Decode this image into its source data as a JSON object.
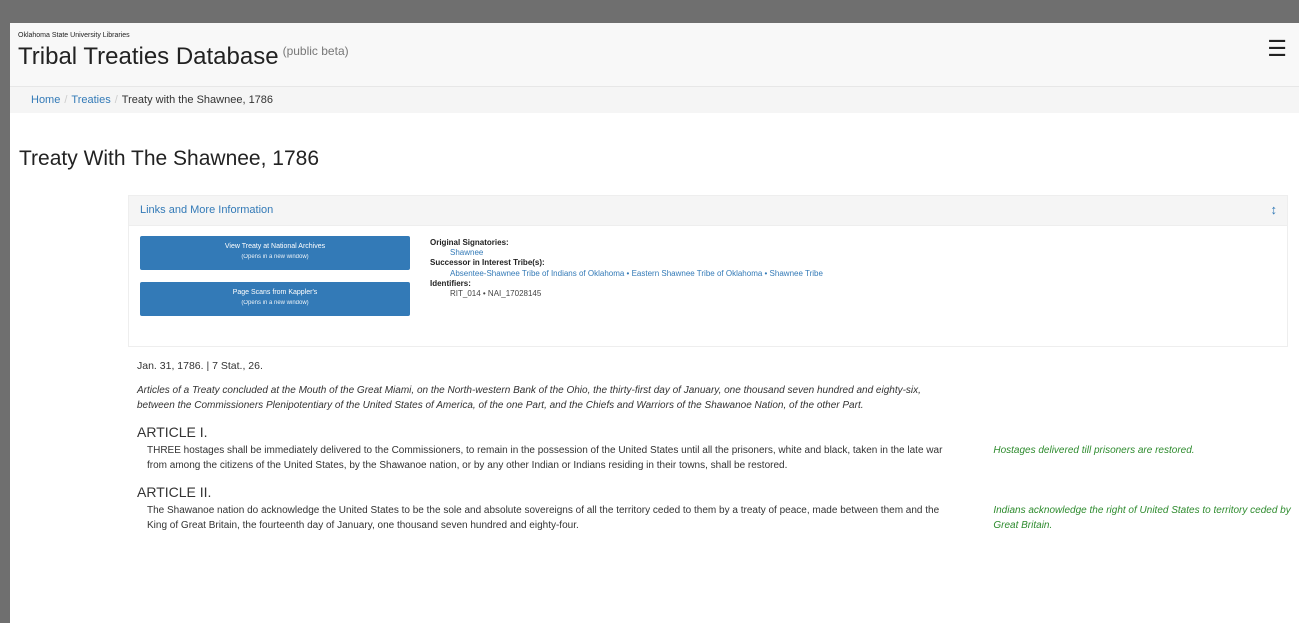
{
  "header": {
    "org": "Oklahoma State University Libraries",
    "title": "Tribal Treaties Database",
    "beta": "(public beta)",
    "menu_icon": "hamburger-icon"
  },
  "breadcrumb": {
    "home": "Home",
    "treaties": "Treaties",
    "current": "Treaty with the Shawnee, 1786"
  },
  "page_title": "Treaty With The Shawnee, 1786",
  "panel": {
    "heading": "Links and More Information",
    "expand_icon": "expand-vertical-icon",
    "button1": {
      "label": "View Treaty at National Archives",
      "sub": "(Opens in a new window)"
    },
    "button2": {
      "label": "Page Scans from Kappler's",
      "sub": "(Opens in a new window)"
    },
    "signatories_label": "Original Signatories:",
    "signatories": "Shawnee",
    "successor_label": "Successor in Interest Tribe(s):",
    "successors": "Absentee-Shawnee Tribe of Indians of Oklahoma • Eastern Shawnee Tribe of Oklahoma • Shawnee Tribe",
    "identifiers_label": "Identifiers:",
    "identifiers": "RIT_014 • NAI_17028145"
  },
  "treaty": {
    "meta": "Jan. 31, 1786. | 7 Stat., 26.",
    "preamble": "Articles of a Treaty concluded at the Mouth of the Great Miami, on the North-western Bank of the Ohio, the thirty-first day of January, one thousand seven hundred and eighty-six, between the Commissioners Plenipotentiary of the United States of America, of the one Part, and the Chiefs and Warriors of the Shawanoe Nation, of the other Part.",
    "articles": [
      {
        "heading": "ARTICLE I.",
        "text": "THREE hostages shall be immediately delivered to the Commissioners, to remain in the possession of the United States until all the prisoners, white and black, taken in the late war from among the citizens of the United States, by the Shawanoe nation, or by any other Indian or Indians residing in their towns, shall be restored.",
        "note": "Hostages delivered till prisoners are restored."
      },
      {
        "heading": "ARTICLE II.",
        "text": "The Shawanoe nation do acknowledge the United States to be the sole and absolute sovereigns of all the territory ceded to them by a treaty of peace, made between them and the King of Great Britain, the fourteenth day of January, one thousand seven hundred and eighty-four.",
        "note": "Indians acknowledge the right of United States to territory ceded by Great Britain."
      }
    ]
  }
}
